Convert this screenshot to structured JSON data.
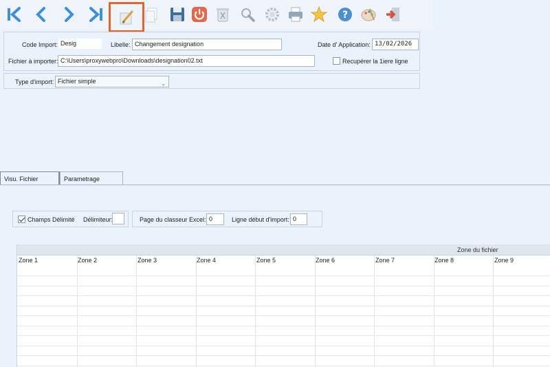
{
  "form": {
    "code_import_label": "Code Import:",
    "code_import_value": "Desig",
    "libelle_label": "Libelle:",
    "libelle_value": "Changement designation",
    "date_label": "Date d' Application:",
    "date_value": "13/02/2026",
    "fichier_label": "Fichier à importer:",
    "fichier_value": "C:\\Users\\proxywebpro\\Downloads\\designation02.txt",
    "recuperer_label": "Recupérer la 1iere ligne",
    "type_label": "Type d'import:",
    "type_value": "Fichier simple"
  },
  "tabs": [
    {
      "label": "Visu. Fichier",
      "active": true
    },
    {
      "label": "Parametrage",
      "active": false
    }
  ],
  "options": {
    "champs_delimite_label": "Champs Délimité",
    "delimiteur_label": "Délimiteur:",
    "delimiteur_value": "",
    "page_label": "Page du classeur Excel:",
    "page_value": "0",
    "ligne_label": "Ligne début d'import:",
    "ligne_value": "0"
  },
  "grid": {
    "band_label": "Zone du fichier",
    "columns": [
      "Zone 1",
      "Zone 2",
      "Zone 3",
      "Zone 4",
      "Zone 5",
      "Zone 6",
      "Zone 7",
      "Zone 8",
      "Zone 9"
    ]
  },
  "toolbar_icons": [
    "first-icon",
    "previous-icon",
    "next-icon",
    "last-icon",
    "edit-icon",
    "copy-icon",
    "save-icon",
    "power-icon",
    "trash-icon",
    "search-icon",
    "gear-icon",
    "print-icon",
    "star-icon",
    "help-icon",
    "palette-icon",
    "exit-icon"
  ],
  "colors": {
    "accent_blue": "#3f8fd8",
    "highlight": "#e8622a"
  }
}
